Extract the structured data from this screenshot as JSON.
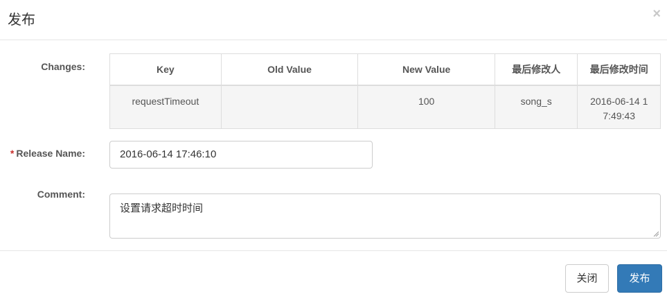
{
  "header": {
    "title": "发布",
    "close_glyph": "×"
  },
  "labels": {
    "changes": "Changes:",
    "release_name": "Release Name:",
    "required_mark": "*",
    "comment": "Comment:"
  },
  "changes_table": {
    "columns": [
      "Key",
      "Old Value",
      "New Value",
      "最后修改人",
      "最后修改时间"
    ],
    "rows": [
      {
        "key": "requestTimeout",
        "old_value": "",
        "new_value": "100",
        "modifier": "song_s",
        "modified_time_line1": "2016-06-14 1",
        "modified_time_line2": "7:49:43"
      }
    ]
  },
  "release_name": {
    "value": "2016-06-14 17:46:10"
  },
  "comment": {
    "value": "设置请求超时时间"
  },
  "footer": {
    "close_label": "关闭",
    "publish_label": "发布"
  },
  "colors": {
    "primary": "#337ab7",
    "required": "#c9302c"
  }
}
